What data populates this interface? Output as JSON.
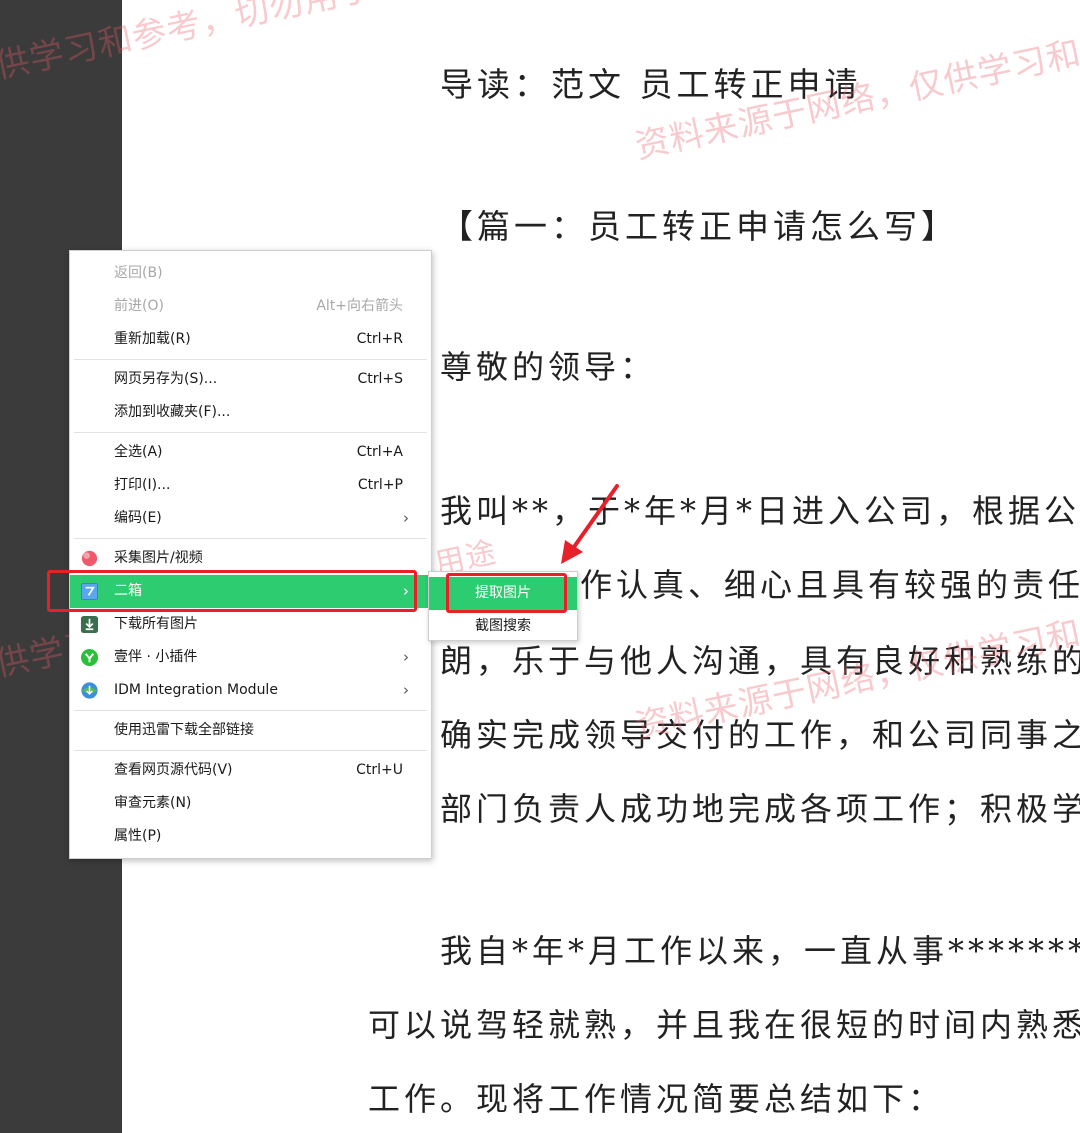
{
  "document": {
    "title": "导读：范文 员工转正申请",
    "section_heading": "【篇一：员工转正申请怎么写】",
    "greeting": "尊敬的领导：",
    "lines": [
      "我叫**，于*年*月*日进入公司，根据公司",
      "作认真、细心且具有较强的责任",
      "朗，乐于与他人沟通，具有良好和熟练的",
      "确实完成领导交付的工作，和公司同事之",
      "部门负责人成功地完成各项工作；积极学",
      "我自*年*月工作以来，一直从事*********",
      "可以说驾轻就熟，并且我在很短的时间内熟悉",
      "工作。现将工作情况简要总结如下："
    ],
    "line_fragment": "，",
    "watermarks": [
      "供学习和参考，切勿用于商业",
      "资料来源于网络，仅供学习和参",
      "用途",
      "供学习",
      "资料来源于网络，仅供学习和参"
    ]
  },
  "context_menu": {
    "items": [
      {
        "label": "返回(B)",
        "shortcut": "",
        "disabled": true
      },
      {
        "label": "前进(O)",
        "shortcut": "Alt+向右箭头",
        "disabled": true
      },
      {
        "label": "重新加载(R)",
        "shortcut": "Ctrl+R"
      },
      {
        "label": "网页另存为(S)...",
        "shortcut": "Ctrl+S"
      },
      {
        "label": "添加到收藏夹(F)...",
        "shortcut": ""
      },
      {
        "label": "全选(A)",
        "shortcut": "Ctrl+A"
      },
      {
        "label": "打印(I)...",
        "shortcut": "Ctrl+P"
      },
      {
        "label": "编码(E)",
        "arrow": "›"
      },
      {
        "label": "采集图片/视频",
        "icon": "collect-icon"
      },
      {
        "label": "二箱",
        "icon": "erxiang-icon",
        "arrow": "›"
      },
      {
        "label": "下载所有图片",
        "icon": "download-images-icon"
      },
      {
        "label": "壹伴 · 小插件",
        "icon": "yiban-icon",
        "arrow": "›"
      },
      {
        "label": "IDM Integration Module",
        "icon": "idm-icon",
        "arrow": "›"
      },
      {
        "label": "使用迅雷下载全部链接",
        "shortcut": ""
      },
      {
        "label": "查看网页源代码(V)",
        "shortcut": "Ctrl+U"
      },
      {
        "label": "审查元素(N)",
        "shortcut": ""
      },
      {
        "label": "属性(P)",
        "shortcut": ""
      }
    ],
    "submenu": [
      {
        "label": "提取图片"
      },
      {
        "label": "截图搜索"
      }
    ]
  },
  "colors": {
    "highlight_green": "#2ecc71",
    "annotation_red": "#e8202a",
    "sidebar_dark": "#3b3b3b"
  }
}
